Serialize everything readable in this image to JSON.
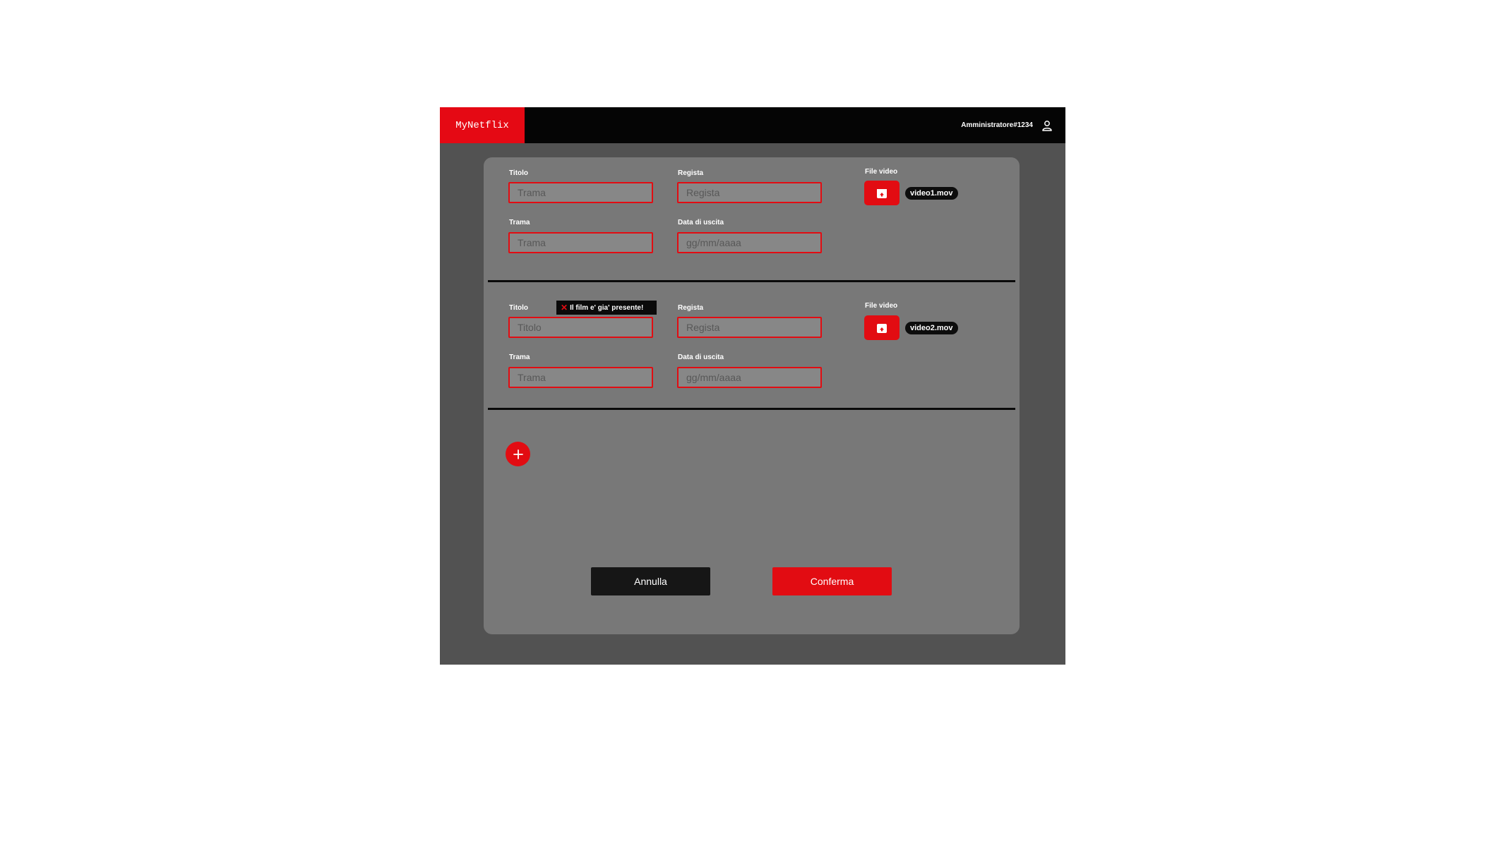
{
  "app": {
    "logo": "MyNetflix",
    "user_name": "Amministratore#1234",
    "accent_color": "#e20c12"
  },
  "movies": [
    {
      "title_label": "Titolo",
      "title_placeholder": "Trama",
      "director_label": "Regista",
      "director_placeholder": "Regista",
      "plot_label": "Trama",
      "plot_placeholder": "Trama",
      "date_label": "Data di uscita",
      "date_placeholder": "gg/mm/aaaa",
      "file_label": "File video",
      "file_name": "video1.mov",
      "upload_icon": "upload-box-icon"
    },
    {
      "title_label": "Titolo",
      "title_placeholder": "Titolo",
      "title_error": "Il film e' gia' presente!",
      "error_icon": "close-icon",
      "director_label": "Regista",
      "director_placeholder": "Regista",
      "plot_label": "Trama",
      "plot_placeholder": "Trama",
      "date_label": "Data di uscita",
      "date_placeholder": "gg/mm/aaaa",
      "file_label": "File video",
      "file_name": "video2.mov",
      "upload_icon": "upload-box-icon"
    }
  ],
  "actions": {
    "add_icon": "plus-icon",
    "cancel_label": "Annulla",
    "confirm_label": "Conferma"
  }
}
